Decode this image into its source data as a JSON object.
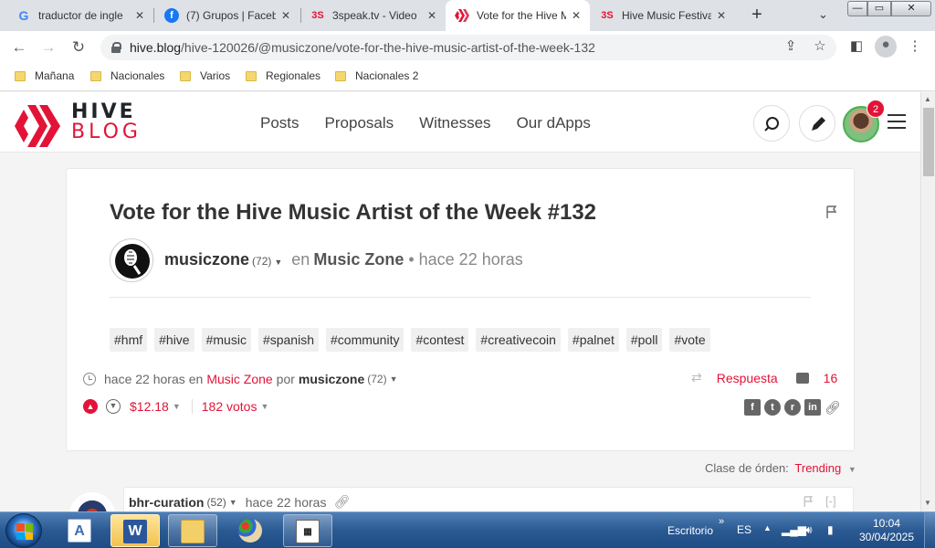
{
  "browser": {
    "tabs": [
      {
        "label": "traductor de ingle",
        "favicon": "G",
        "favicon_color": "#4285f4"
      },
      {
        "label": "(7) Grupos | Faceb",
        "favicon": "f",
        "favicon_color": "#1877f2"
      },
      {
        "label": "3speak.tv - Video",
        "favicon": "3S",
        "favicon_color": "#e31337"
      },
      {
        "label": "Vote for the Hive M",
        "favicon": "hive-icon",
        "favicon_color": "#e31337",
        "active": true
      },
      {
        "label": "Hive Music Festiva",
        "favicon": "3S",
        "favicon_color": "#e31337"
      }
    ],
    "new_tab": "+",
    "window_controls": {
      "minimize": "—",
      "maximize": "▭",
      "close": "✕"
    },
    "url": {
      "host": "hive.blog",
      "path": "/hive-120026/@musiczone/vote-for-the-hive-music-artist-of-the-week-132"
    },
    "bookmarks": [
      "Mañana",
      "Nacionales",
      "Varios",
      "Regionales",
      "Nacionales 2"
    ]
  },
  "hive": {
    "logo": {
      "line1": "HIVE",
      "line2": "BLOG",
      "brand_color": "#e31337"
    },
    "nav": [
      "Posts",
      "Proposals",
      "Witnesses",
      "Our dApps"
    ],
    "notifications": "2"
  },
  "post": {
    "title": "Vote for the Hive Music Artist of the Week #132",
    "author": "musiczone",
    "reputation": "(72)",
    "in_label": "en",
    "community": "Music Zone",
    "time": "• hace 22 horas",
    "tags": [
      "#hmf",
      "#hive",
      "#music",
      "#spanish",
      "#community",
      "#contest",
      "#creativecoin",
      "#palnet",
      "#poll",
      "#vote"
    ],
    "meta": {
      "time": "hace 22 horas",
      "in_label": "en",
      "community": "Music Zone",
      "by_label": "por",
      "author": "musiczone",
      "reputation": "(72)"
    },
    "reply_label": "Respuesta",
    "comments_count": "16",
    "payout": "$12.18",
    "votes": "182 votos",
    "share_icons": [
      "facebook-icon",
      "twitter-icon",
      "reddit-icon",
      "linkedin-icon",
      "link-icon"
    ]
  },
  "comments": {
    "sort_label": "Clase de órden:",
    "sort_value": "Trending",
    "first": {
      "author": "bhr-curation",
      "reputation": "(52)",
      "time": "hace 22 horas",
      "collapse": "[-]"
    }
  },
  "taskbar": {
    "apps": [
      "word-icon",
      "folder-icon",
      "paint-icon",
      "calculator-icon"
    ],
    "desktop_label": "Escritorio",
    "chevron": "»",
    "language": "ES",
    "time": "10:04",
    "date": "30/04/2025"
  }
}
